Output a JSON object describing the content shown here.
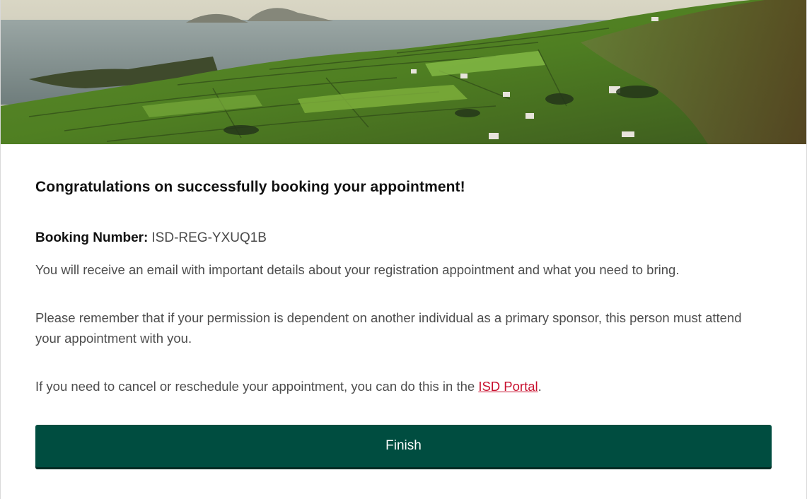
{
  "hero": {
    "image": "irish-coastal-landscape"
  },
  "confirmation": {
    "title": "Congratulations on successfully booking your appointment!",
    "booking_label": "Booking Number:",
    "booking_number": "ISD-REG-YXUQ1B",
    "paragraph_email": "You will receive an email with important details about your registration appointment and what you need to bring.",
    "paragraph_sponsor": "Please remember that if your permission is dependent on another individual as a primary sponsor, this person must attend your appointment with you.",
    "paragraph_cancel_prefix": "If you need to cancel or reschedule your appointment, you can do this in the ",
    "portal_link": "ISD Portal",
    "paragraph_cancel_suffix": ".",
    "finish_label": "Finish"
  },
  "colors": {
    "button_bg": "#004d40",
    "link": "#c8102e",
    "title": "#111111",
    "body_text": "#4d4d4d"
  }
}
